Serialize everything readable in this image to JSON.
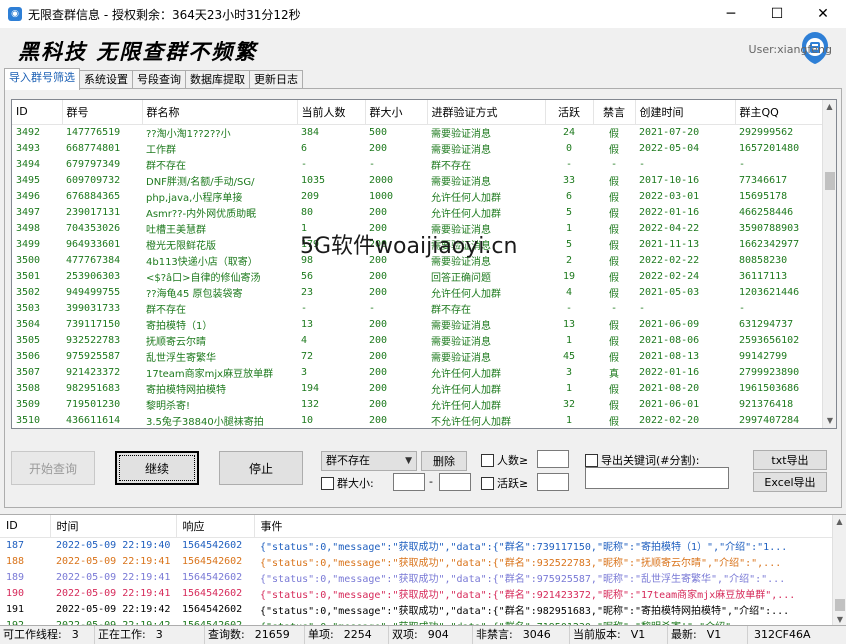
{
  "window": {
    "title": "无限查群信息 - 授权剩余：364天23小时31分12秒",
    "controls": [
      "minimize",
      "maximize",
      "close"
    ]
  },
  "header": {
    "brand": "黑科技 无限查群不频繁",
    "user": "User:xiangfeng"
  },
  "tabs": [
    {
      "label": "导入群号筛选",
      "active": true
    },
    {
      "label": "系统设置",
      "active": false
    },
    {
      "label": "号段查询",
      "active": false
    },
    {
      "label": "数据库提取",
      "active": false
    },
    {
      "label": "更新日志",
      "active": false
    }
  ],
  "grid": {
    "columns": [
      "ID",
      "群号",
      "群名称",
      "当前人数",
      "群大小",
      "进群验证方式",
      "活跃",
      "禁言",
      "创建时间",
      "群主QQ"
    ],
    "rows": [
      [
        "3492",
        "147776519",
        "??淘小淘1??2??小",
        "384",
        "500",
        "需要验证消息",
        "24",
        "假",
        "2021-07-20",
        "292999562"
      ],
      [
        "3493",
        "668774801",
        "工作群",
        "6",
        "200",
        "需要验证消息",
        "0",
        "假",
        "2022-05-04",
        "1657201480"
      ],
      [
        "3494",
        "679797349",
        "群不存在",
        "-",
        "-",
        "群不存在",
        "-",
        "-",
        "-",
        "-"
      ],
      [
        "3495",
        "609709732",
        "DNF胖测/名额/手动/SG/",
        "1035",
        "2000",
        "需要验证消息",
        "33",
        "假",
        "2017-10-16",
        "77346617"
      ],
      [
        "3496",
        "676884365",
        "php,java,小程序单接",
        "209",
        "1000",
        "允许任何人加群",
        "6",
        "假",
        "2022-03-01",
        "15695178"
      ],
      [
        "3497",
        "239017131",
        "Asmr??-内外网优质助眠",
        "80",
        "200",
        "允许任何人加群",
        "5",
        "假",
        "2022-01-16",
        "466258446"
      ],
      [
        "3498",
        "704353026",
        "吐槽王美慧群",
        "1",
        "200",
        "需要验证消息",
        "1",
        "假",
        "2022-04-22",
        "3590788903"
      ],
      [
        "3499",
        "964933601",
        "橙光无限鲜花版",
        "179",
        "200",
        "需要验证消息",
        "5",
        "假",
        "2021-11-13",
        "1662342977"
      ],
      [
        "3500",
        "477767384",
        "4b113快递小店（取寄）",
        "98",
        "200",
        "需要验证消息",
        "2",
        "假",
        "2022-02-22",
        "80858230"
      ],
      [
        "3501",
        "253906303",
        "<$?â口>自律的修仙寄汤",
        "56",
        "200",
        "回答正确问题",
        "19",
        "假",
        "2022-02-24",
        "36117113"
      ],
      [
        "3502",
        "949499755",
        "??海龟45 原包装袋寄",
        "23",
        "200",
        "允许任何人加群",
        "4",
        "假",
        "2021-05-03",
        "1203621446"
      ],
      [
        "3503",
        "399031733",
        "群不存在",
        "-",
        "-",
        "群不存在",
        "-",
        "-",
        "-",
        "-"
      ],
      [
        "3504",
        "739117150",
        "寄拍模特（1）",
        "13",
        "200",
        "需要验证消息",
        "13",
        "假",
        "2021-06-09",
        "631294737"
      ],
      [
        "3505",
        "932522783",
        "抚顺寄云尔晴",
        "4",
        "200",
        "需要验证消息",
        "1",
        "假",
        "2021-08-06",
        "2593656102"
      ],
      [
        "3506",
        "975925587",
        "乱世浮生寄繁华",
        "72",
        "200",
        "需要验证消息",
        "45",
        "假",
        "2021-08-13",
        "99142799"
      ],
      [
        "3507",
        "921423372",
        "17team商家mjx麻豆放单群",
        "3",
        "200",
        "允许任何人加群",
        "3",
        "真",
        "2022-01-16",
        "2799923890"
      ],
      [
        "3508",
        "982951683",
        "寄拍模特网拍模特",
        "194",
        "200",
        "允许任何人加群",
        "1",
        "假",
        "2021-08-20",
        "1961503686"
      ],
      [
        "3509",
        "719501230",
        "黎明杀寄!",
        "132",
        "200",
        "允许任何人加群",
        "32",
        "假",
        "2021-06-01",
        "921376418"
      ],
      [
        "3510",
        "436611614",
        "3.5兔子38840小腿袜寄拍",
        "10",
        "200",
        "不允许任何人加群",
        "1",
        "假",
        "2022-02-20",
        "2997407284"
      ]
    ]
  },
  "watermark": "5G软件woaijiaoyi.cn",
  "controls": {
    "start_label": "开始查询",
    "continue_label": "继续",
    "stop_label": "停止",
    "filter_select_value": "群不存在",
    "delete_label": "删除",
    "people_label": "人数≥",
    "size_label": "群大小:",
    "size_sep": "-",
    "active_label": "活跃≥",
    "export_keywords_label": "导出关键词(#分割):",
    "txt_export_label": "txt导出",
    "excel_export_label": "Excel导出"
  },
  "log": {
    "columns": [
      "ID",
      "时间",
      "响应",
      "事件"
    ],
    "rows": [
      {
        "id": "187",
        "time": "2022-05-09 22:19:40",
        "resp": "1564542602",
        "event": "{\"status\":0,\"message\":\"获取成功\",\"data\":{\"群名\":739117150,\"昵称\":\"寄拍模特（1）\",\"介绍\":\"1...",
        "color": "#1f5fbf"
      },
      {
        "id": "188",
        "time": "2022-05-09 22:19:41",
        "resp": "1564542602",
        "event": "{\"status\":0,\"message\":\"获取成功\",\"data\":{\"群名\":932522783,\"昵称\":\"抚顺寄云尔晴\",\"介绍\":\",...",
        "color": "#d9731a"
      },
      {
        "id": "189",
        "time": "2022-05-09 22:19:41",
        "resp": "1564542602",
        "event": "{\"status\":0,\"message\":\"获取成功\",\"data\":{\"群名\":975925587,\"昵称\":\"乱世浮生寄繁华\",\"介绍\":\"...",
        "color": "#7a7ad6"
      },
      {
        "id": "190",
        "time": "2022-05-09 22:19:41",
        "resp": "1564542602",
        "event": "{\"status\":0,\"message\":\"获取成功\",\"data\":{\"群名\":921423372,\"昵称\":\"17team商家mjx麻豆放单群\",...",
        "color": "#d62a5a"
      },
      {
        "id": "191",
        "time": "2022-05-09 22:19:42",
        "resp": "1564542602",
        "event": "{\"status\":0,\"message\":\"获取成功\",\"data\":{\"群名\":982951683,\"昵称\":\"寄拍模特网拍模特\",\"介绍\":...",
        "color": "#000000"
      },
      {
        "id": "192",
        "time": "2022-05-09 22:19:42",
        "resp": "1564542602",
        "event": "{\"status\":0,\"message\":\"获取成功\",\"data\":{\"群名\":719501230,\"昵称\":\"黎明杀寄!\",\"介绍\":...",
        "color": "#1e7a1e"
      }
    ]
  },
  "status": [
    {
      "label": "可工作线程:",
      "value": "3"
    },
    {
      "label": "正在工作:",
      "value": "3"
    },
    {
      "label": "查询数:",
      "value": "21659"
    },
    {
      "label": "单项:",
      "value": "2254"
    },
    {
      "label": "双项:",
      "value": "904"
    },
    {
      "label": "非禁言:",
      "value": "3046"
    },
    {
      "label": "当前版本:",
      "value": "V1"
    },
    {
      "label": "最新:",
      "value": "V1"
    },
    {
      "label": "",
      "value": "312CF46A"
    }
  ],
  "colors": {
    "accent": "#1a5fb4",
    "row_text": "#1e7a1e",
    "logo": "#2e7fd6"
  }
}
